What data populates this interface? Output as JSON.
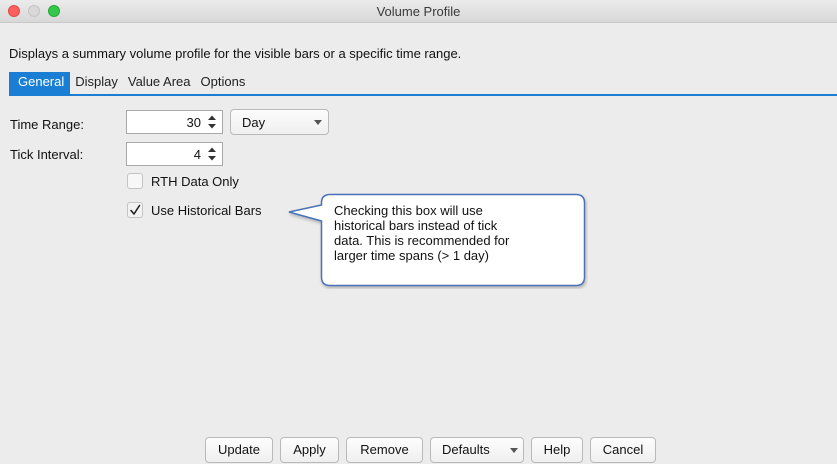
{
  "window": {
    "title": "Volume Profile"
  },
  "description": "Displays a summary volume profile for the visible bars or a specific time range.",
  "tabs": [
    {
      "label": "General",
      "active": true
    },
    {
      "label": "Display",
      "active": false
    },
    {
      "label": "Value Area",
      "active": false
    },
    {
      "label": "Options",
      "active": false
    }
  ],
  "form": {
    "time_range": {
      "label": "Time Range:",
      "value": "30",
      "unit": "Day"
    },
    "tick_interval": {
      "label": "Tick Interval:",
      "value": "4"
    },
    "rth_data_only": {
      "label": "RTH Data Only",
      "checked": false
    },
    "use_historical_bars": {
      "label": "Use Historical Bars",
      "checked": true
    }
  },
  "callout": {
    "lines": [
      "Checking this box will use",
      "historical bars instead of tick",
      "data.  This is recommended for",
      "larger time spans (> 1 day)"
    ]
  },
  "buttons": {
    "update": "Update",
    "apply": "Apply",
    "remove": "Remove",
    "defaults": "Defaults",
    "help": "Help",
    "cancel": "Cancel"
  },
  "colors": {
    "accent": "#1a7fd4",
    "callout_border": "#4a72b8"
  }
}
